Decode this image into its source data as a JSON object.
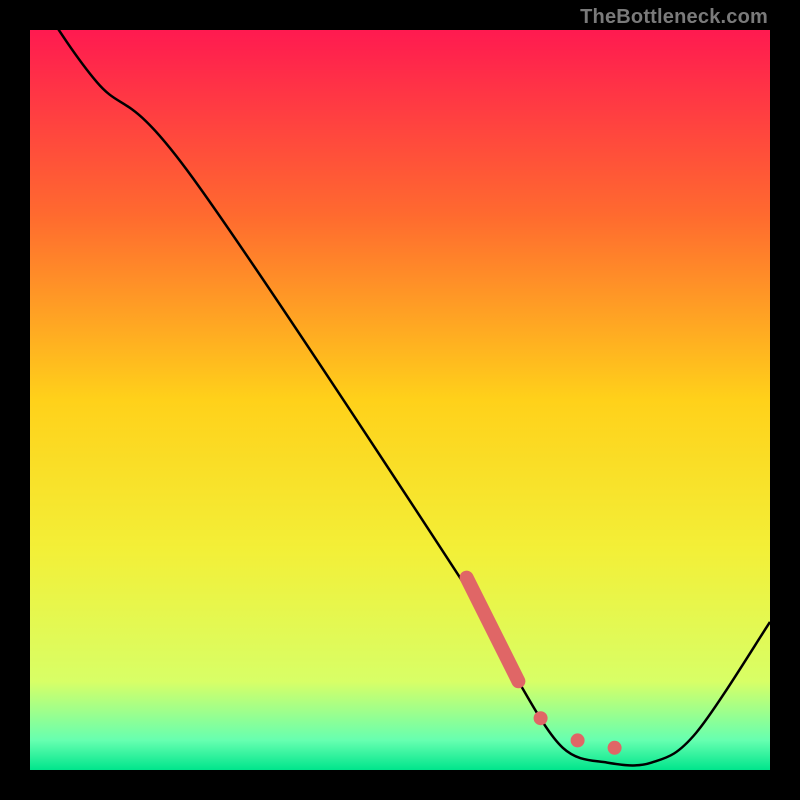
{
  "watermark": "TheBottleneck.com",
  "chart_data": {
    "type": "line",
    "title": "",
    "xlabel": "",
    "ylabel": "",
    "xlim": [
      0,
      100
    ],
    "ylim": [
      0,
      100
    ],
    "gradient_stops": [
      {
        "offset": 0,
        "color": "#ff1a50"
      },
      {
        "offset": 25,
        "color": "#ff6a2f"
      },
      {
        "offset": 50,
        "color": "#ffd11a"
      },
      {
        "offset": 70,
        "color": "#f3ef37"
      },
      {
        "offset": 88,
        "color": "#d8ff66"
      },
      {
        "offset": 96,
        "color": "#66ffb0"
      },
      {
        "offset": 100,
        "color": "#00e58c"
      }
    ],
    "series": [
      {
        "name": "curve",
        "color": "#000000",
        "points": [
          {
            "x": 0,
            "y": 106
          },
          {
            "x": 9,
            "y": 93
          },
          {
            "x": 22,
            "y": 80
          },
          {
            "x": 62,
            "y": 20
          },
          {
            "x": 66,
            "y": 12
          },
          {
            "x": 72,
            "y": 3
          },
          {
            "x": 78,
            "y": 1
          },
          {
            "x": 84,
            "y": 1
          },
          {
            "x": 90,
            "y": 5
          },
          {
            "x": 100,
            "y": 20
          }
        ]
      }
    ],
    "highlight_segment": {
      "color": "#e06666",
      "points": [
        {
          "x": 59,
          "y": 26
        },
        {
          "x": 66,
          "y": 12
        }
      ]
    },
    "highlight_dots": {
      "color": "#e06666",
      "radius": 7,
      "points": [
        {
          "x": 69,
          "y": 7
        },
        {
          "x": 74,
          "y": 4
        },
        {
          "x": 79,
          "y": 3
        }
      ]
    }
  }
}
